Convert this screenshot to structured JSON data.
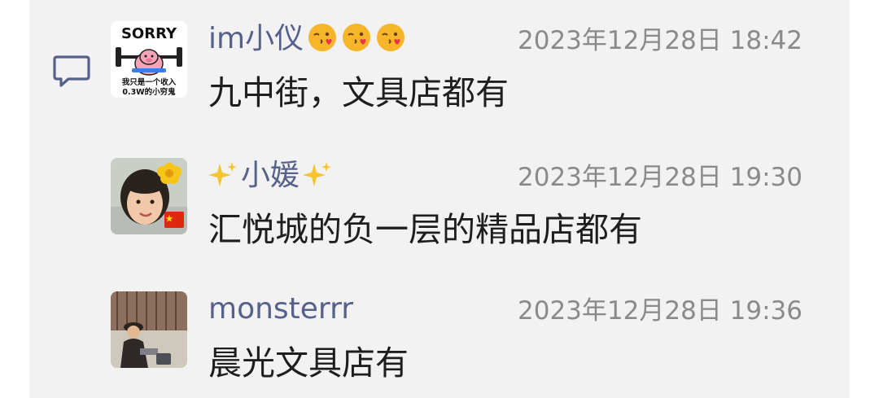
{
  "icons": {
    "comment": "chat-bubble-icon",
    "name_emoji": "kissing-face-emoji",
    "sparkles": "sparkles-emoji",
    "flag": "china-flag-icon",
    "flower": "flower-icon"
  },
  "avatar1_text": {
    "top": "SORRY",
    "line1": "我只是一个收入",
    "line2": "0.3W的小穷鬼"
  },
  "comments": [
    {
      "name": "im小仪",
      "time": "2023年12月28日 18:42",
      "text": "九中街，文具店都有"
    },
    {
      "name": "小媛",
      "time": "2023年12月28日 19:30",
      "text": "汇悦城的负一层的精品店都有"
    },
    {
      "name": "monsterrr",
      "time": "2023年12月28日 19:36",
      "text": "晨光文具店有"
    }
  ],
  "colors": {
    "panel_bg": "#f2f2f2",
    "name": "#55618a",
    "time": "#8a8a8a",
    "text": "#1e1e1e",
    "icon": "#55618a"
  }
}
